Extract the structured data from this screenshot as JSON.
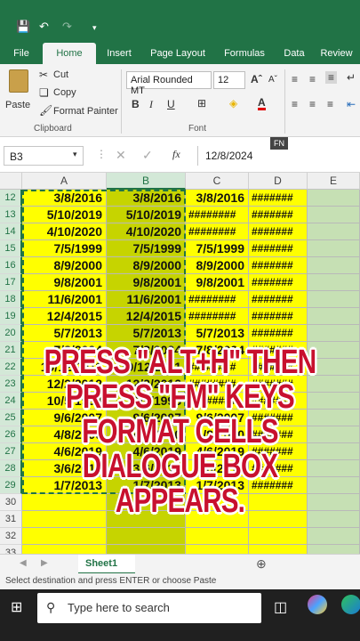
{
  "titlebar": {
    "save_icon": "save-icon",
    "undo_icon": "undo-icon",
    "redo_icon": "redo-icon"
  },
  "tabs": [
    "File",
    "Home",
    "Insert",
    "Page Layout",
    "Formulas",
    "Data",
    "Review"
  ],
  "ribbon": {
    "paste_label": "Paste",
    "cut_label": "Cut",
    "copy_label": "Copy",
    "format_painter_label": "Format Painter",
    "clipboard_label": "Clipboard",
    "font_name": "Arial Rounded MT",
    "font_size": "12",
    "font_label": "Font",
    "bold": "B",
    "italic": "I",
    "underline": "U"
  },
  "formula_bar": {
    "name_box": "B3",
    "fx": "fx",
    "value": "12/8/2024",
    "fn_badge": "FN"
  },
  "columns": [
    "A",
    "B",
    "C",
    "D",
    "E"
  ],
  "rows": [
    {
      "n": "12",
      "a": "3/8/2016",
      "b": "3/8/2016",
      "c": "3/8/2016",
      "d": "#######"
    },
    {
      "n": "13",
      "a": "5/10/2019",
      "b": "5/10/2019",
      "c": "########",
      "d": "#######"
    },
    {
      "n": "14",
      "a": "4/10/2020",
      "b": "4/10/2020",
      "c": "########",
      "d": "#######"
    },
    {
      "n": "15",
      "a": "7/5/1999",
      "b": "7/5/1999",
      "c": "7/5/1999",
      "d": "#######"
    },
    {
      "n": "16",
      "a": "8/9/2000",
      "b": "8/9/2000",
      "c": "8/9/2000",
      "d": "#######"
    },
    {
      "n": "17",
      "a": "9/8/2001",
      "b": "9/8/2001",
      "c": "9/8/2001",
      "d": "#######"
    },
    {
      "n": "18",
      "a": "11/6/2001",
      "b": "11/6/2001",
      "c": "########",
      "d": "#######"
    },
    {
      "n": "19",
      "a": "12/4/2015",
      "b": "12/4/2015",
      "c": "########",
      "d": "#######"
    },
    {
      "n": "20",
      "a": "5/7/2013",
      "b": "5/7/2013",
      "c": "5/7/2013",
      "d": "#######"
    },
    {
      "n": "21",
      "a": "7/8/2024",
      "b": "7/8/2024",
      "c": "7/8/2024",
      "d": "#######"
    },
    {
      "n": "22",
      "a": "10/12/2011",
      "b": "10/12/2011",
      "c": "########",
      "d": "#######"
    },
    {
      "n": "23",
      "a": "12/2/2012",
      "b": "12/2/2012",
      "c": "########",
      "d": "#######"
    },
    {
      "n": "24",
      "a": "10/5/1998",
      "b": "10/5/1998",
      "c": "########",
      "d": "#######"
    },
    {
      "n": "25",
      "a": "9/6/2007",
      "b": "9/6/2007",
      "c": "9/6/2007",
      "d": "#######"
    },
    {
      "n": "26",
      "a": "4/8/2000",
      "b": "4/8/2000",
      "c": "4/8/2000",
      "d": "#######"
    },
    {
      "n": "27",
      "a": "4/6/2019",
      "b": "4/6/2019",
      "c": "4/6/2019",
      "d": "#######"
    },
    {
      "n": "28",
      "a": "3/6/2018",
      "b": "3/6/2018",
      "c": "3/6/2018",
      "d": "#######"
    },
    {
      "n": "29",
      "a": "1/7/2013",
      "b": "1/7/2013",
      "c": "1/7/2013",
      "d": "#######"
    },
    {
      "n": "30",
      "a": "",
      "b": "",
      "c": "",
      "d": ""
    },
    {
      "n": "31",
      "a": "",
      "b": "",
      "c": "",
      "d": ""
    },
    {
      "n": "32",
      "a": "",
      "b": "",
      "c": "",
      "d": ""
    },
    {
      "n": "33",
      "a": "",
      "b": "",
      "c": "",
      "d": ""
    }
  ],
  "overlay": [
    "PRESS \"ALT+H\" THEN",
    "PRESS \"FM\" KEYS",
    "FORMAT CELLS",
    "DIALOGUE BOX",
    "APPEARS."
  ],
  "sheet_tab": "Sheet1",
  "status": "Select destination and press ENTER or choose Paste",
  "taskbar": {
    "search_placeholder": "Type here to search"
  },
  "colors": {
    "excel_green": "#217346",
    "cell_yellow": "#ffff00",
    "overlay_red": "#c8102e"
  }
}
